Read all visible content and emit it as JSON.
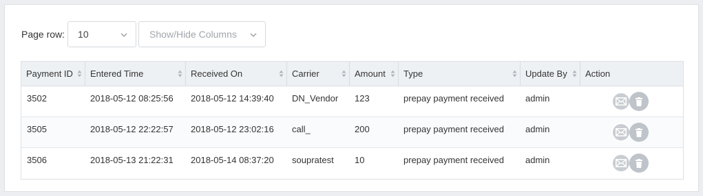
{
  "toolbar": {
    "page_row_label": "Page row:",
    "page_row_value": "10",
    "columns_placeholder": "Show/Hide Columns"
  },
  "table": {
    "headers": [
      "Payment ID",
      "Entered Time",
      "Received On",
      "Carrier",
      "Amount",
      "Type",
      "Update By",
      "Action"
    ],
    "rows": [
      {
        "payment_id": "3502",
        "entered_time": "2018-05-12 08:25:56",
        "received_on": "2018-05-12 14:39:40",
        "carrier": "DN_Vendor",
        "amount": "123",
        "type": "prepay payment received",
        "update_by": "admin"
      },
      {
        "payment_id": "3505",
        "entered_time": "2018-05-12 22:22:57",
        "received_on": "2018-05-12 23:02:16",
        "carrier": "call_",
        "amount": "200",
        "type": "prepay payment received",
        "update_by": "admin"
      },
      {
        "payment_id": "3506",
        "entered_time": "2018-05-13 21:22:31",
        "received_on": "2018-05-14 08:37:20",
        "carrier": "soupratest",
        "amount": "10",
        "type": "prepay payment received",
        "update_by": "admin"
      }
    ],
    "action_icons": [
      "mail-icon",
      "trash-icon"
    ]
  },
  "colors": {
    "header_bg": "#eef1f4",
    "action_icon_bg": "#c7ccd1",
    "border": "#dcdfe3"
  }
}
